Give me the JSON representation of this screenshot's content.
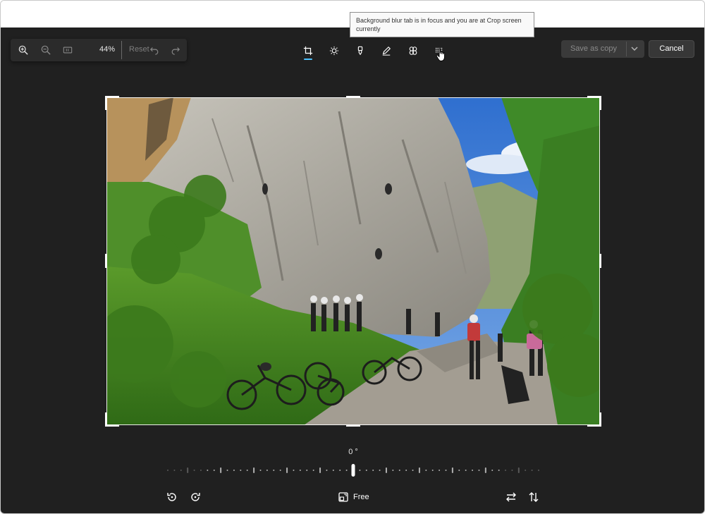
{
  "tooltip": {
    "text": "Background blur tab is in focus and you are at Crop screen currently"
  },
  "zoom": {
    "zoom_in_icon": "zoom-in-icon",
    "zoom_out_icon": "zoom-out-icon",
    "fit_icon": "fit-to-window-icon",
    "value": "44%",
    "reset_label": "Reset",
    "undo_icon": "undo-icon",
    "redo_icon": "redo-icon"
  },
  "tools": [
    {
      "name": "Crop",
      "icon": "crop-icon",
      "active": true
    },
    {
      "name": "Adjustment",
      "icon": "brightness-icon"
    },
    {
      "name": "Retouch",
      "icon": "retouch-icon"
    },
    {
      "name": "Markup",
      "icon": "pen-icon"
    },
    {
      "name": "Filter",
      "icon": "filter-icon"
    },
    {
      "name": "Background blur",
      "icon": "background-blur-icon"
    }
  ],
  "actions": {
    "save_as_copy_label": "Save as copy",
    "cancel_label": "Cancel"
  },
  "straighten": {
    "angle_label": "0 °",
    "value_degrees": 0
  },
  "bottom": {
    "rotate_left_icon": "rotate-left-icon",
    "rotate_right_icon": "rotate-right-icon",
    "aspect_icon": "aspect-ratio-icon",
    "aspect_label": "Free",
    "flip_horizontal_icon": "flip-horizontal-icon",
    "flip_vertical_icon": "flip-vertical-icon"
  },
  "colors": {
    "editor_bg": "#202020",
    "accent": "#4cc2ff",
    "toolbar_bg": "#2b2b2b"
  }
}
